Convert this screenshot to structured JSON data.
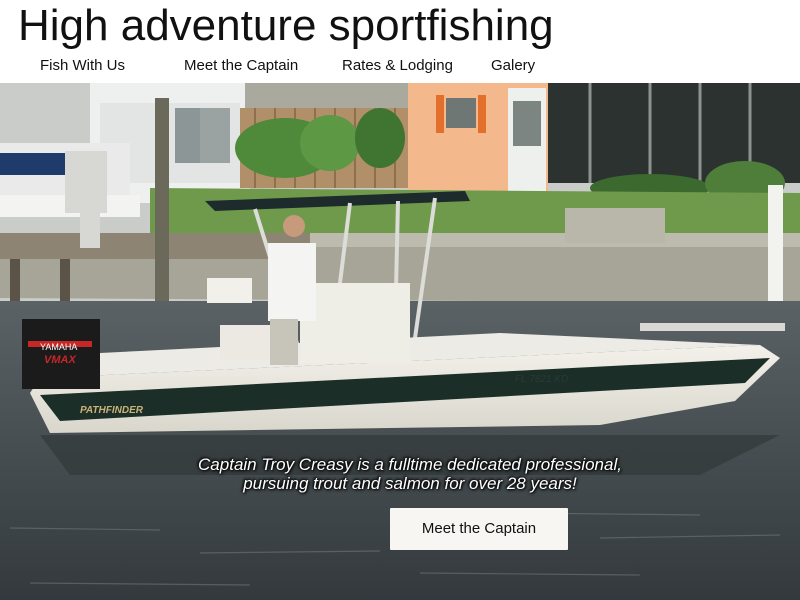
{
  "site": {
    "title": "High adventure sportfishing"
  },
  "nav": {
    "items": [
      {
        "label": "Fish With Us"
      },
      {
        "label": "Meet the Captain"
      },
      {
        "label": "Rates & Lodging"
      },
      {
        "label": "Galery"
      }
    ]
  },
  "hero": {
    "caption_line1": "Captain Troy Creasy is a fulltime dedicated professional,",
    "caption_line2": "pursuing trout and salmon for over 28 years!",
    "cta_label": "Meet the Captain",
    "motor_brand": "YAMAHA",
    "motor_model": "VMAX",
    "boat_brand": "PATHFINDER",
    "boat_reg": "FL 7621 KD"
  },
  "colors": {
    "water": "#3f4548",
    "hull_stripe": "#1c2e28",
    "cta_bg": "#f8f6f2"
  }
}
